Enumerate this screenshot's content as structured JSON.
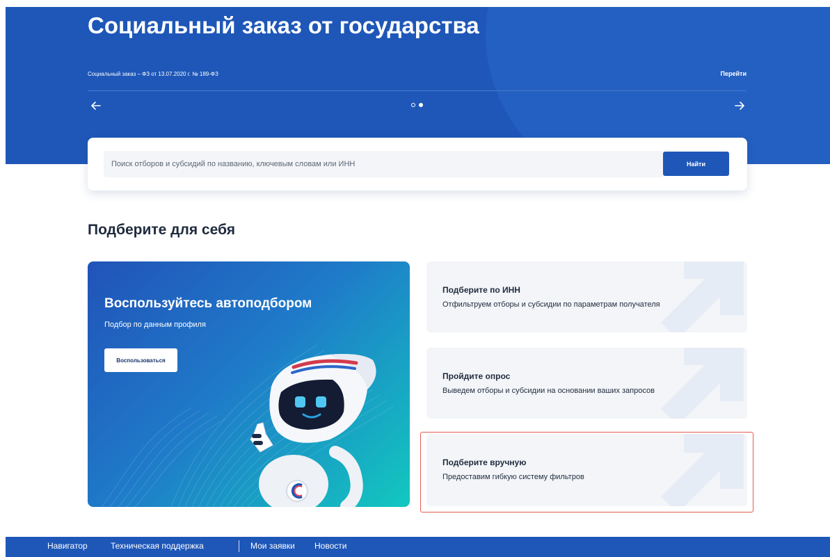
{
  "banner": {
    "title": "Социальный заказ от государства",
    "subtitle": "Социальный заказ – ФЗ от 13.07.2020 г. № 189-ФЗ",
    "link_label": "Перейти",
    "prev_icon": "arrow-left-icon",
    "next_icon": "arrow-right-icon",
    "slides_total": 2,
    "active_slide": 2
  },
  "search": {
    "placeholder": "Поиск отборов и субсидий по названию, ключевым словам или ИНН",
    "value": "",
    "button_label": "Найти"
  },
  "selection": {
    "heading": "Подберите для себя",
    "promo": {
      "title": "Воспользуйтесь автоподбором",
      "subtitle": "Подбор по данным профиля",
      "button_label": "Воспользоваться"
    },
    "options": [
      {
        "title": "Подберите по ИНН",
        "text": "Отфильтруем отборы и субсидии по параметрам получателя"
      },
      {
        "title": "Пройдите опрос",
        "text": "Выведем отборы и субсидии на основании ваших запросов"
      },
      {
        "title": "Подберите вручную",
        "text": "Предоставим гибкую систему фильтров",
        "highlighted": true
      }
    ]
  },
  "footer_nav": {
    "navigator": "Навигатор",
    "support": "Техническая поддержка",
    "my_applications": "Мои заявки",
    "news": "Новости"
  },
  "colors": {
    "brand_blue": "#1e57b8",
    "highlight_red": "#e65a50",
    "card_gray": "#f3f5f8",
    "teal": "#12c8bf"
  }
}
